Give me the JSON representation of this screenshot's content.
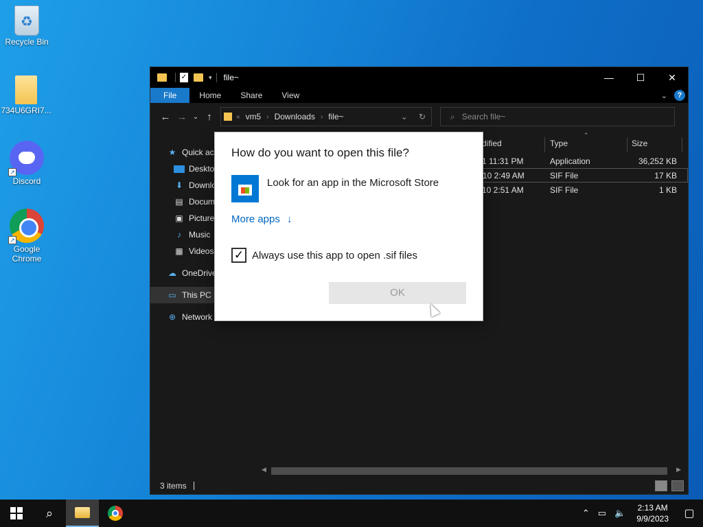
{
  "desktop": {
    "icons": [
      {
        "label": "Recycle Bin"
      },
      {
        "label": "734U6GRI7..."
      },
      {
        "label": "Discord"
      },
      {
        "label": "Google Chrome"
      }
    ]
  },
  "explorer": {
    "title": "file~",
    "ribbon_tabs": [
      "File",
      "Home",
      "Share",
      "View"
    ],
    "address": {
      "prefix": "«",
      "crumbs": [
        "vm5",
        "Downloads",
        "file~"
      ]
    },
    "search_placeholder": "Search file~",
    "nav": [
      {
        "label": "Quick access",
        "icon": "star-icon"
      },
      {
        "label": "Desktop",
        "icon": "desktop-icon"
      },
      {
        "label": "Downloads",
        "icon": "download-icon"
      },
      {
        "label": "Documents",
        "icon": "documents-icon"
      },
      {
        "label": "Pictures",
        "icon": "pictures-icon"
      },
      {
        "label": "Music",
        "icon": "music-icon"
      },
      {
        "label": "Videos",
        "icon": "videos-icon"
      },
      {
        "label": "OneDrive",
        "icon": "cloud-icon"
      },
      {
        "label": "This PC",
        "icon": "pc-icon"
      },
      {
        "label": "Network",
        "icon": "network-icon"
      }
    ],
    "columns": {
      "modified": "dified",
      "type": "Type",
      "size": "Size"
    },
    "files": [
      {
        "modified": "1 11:31 PM",
        "type": "Application",
        "size": "36,252 KB"
      },
      {
        "modified": "10 2:49 AM",
        "type": "SIF File",
        "size": "17 KB"
      },
      {
        "modified": "10 2:51 AM",
        "type": "SIF File",
        "size": "1 KB"
      }
    ],
    "status": "3 items"
  },
  "dialog": {
    "title": "How do you want to open this file?",
    "store_option": "Look for an app in the Microsoft Store",
    "more_apps": "More apps",
    "always_label": "Always use this app to open .sif files",
    "always_checked": true,
    "ok_label": "OK"
  },
  "taskbar": {
    "time": "2:13 AM",
    "date": "9/9/2023"
  }
}
